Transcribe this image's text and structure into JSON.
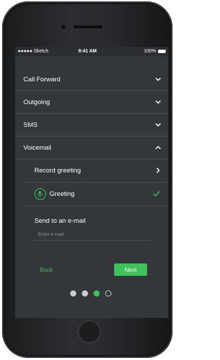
{
  "status_bar": {
    "carrier": "●●●●● Sketch",
    "time": "9:41 AM",
    "battery": "100%"
  },
  "menu": {
    "items": [
      {
        "label": "Call Forward",
        "chevron": "chevron-down-icon"
      },
      {
        "label": "Outgoing",
        "chevron": "chevron-down-icon"
      },
      {
        "label": "SMS",
        "chevron": "chevron-down-icon"
      },
      {
        "label": "Voicemail",
        "chevron": "chevron-up-icon"
      }
    ]
  },
  "voicemail": {
    "record_greeting": "Record greeting",
    "greeting": "Greeting",
    "send_email_label": "Send to an e-mail",
    "email_placeholder": "Enter e-mail",
    "email_value": ""
  },
  "footer": {
    "back_label": "Back",
    "next_label": "Next"
  },
  "pagination": {
    "total": 4,
    "current": 3
  },
  "colors": {
    "accent": "#3fc15c",
    "screen_bg": "#34373a",
    "divider": "#4a4d50"
  }
}
